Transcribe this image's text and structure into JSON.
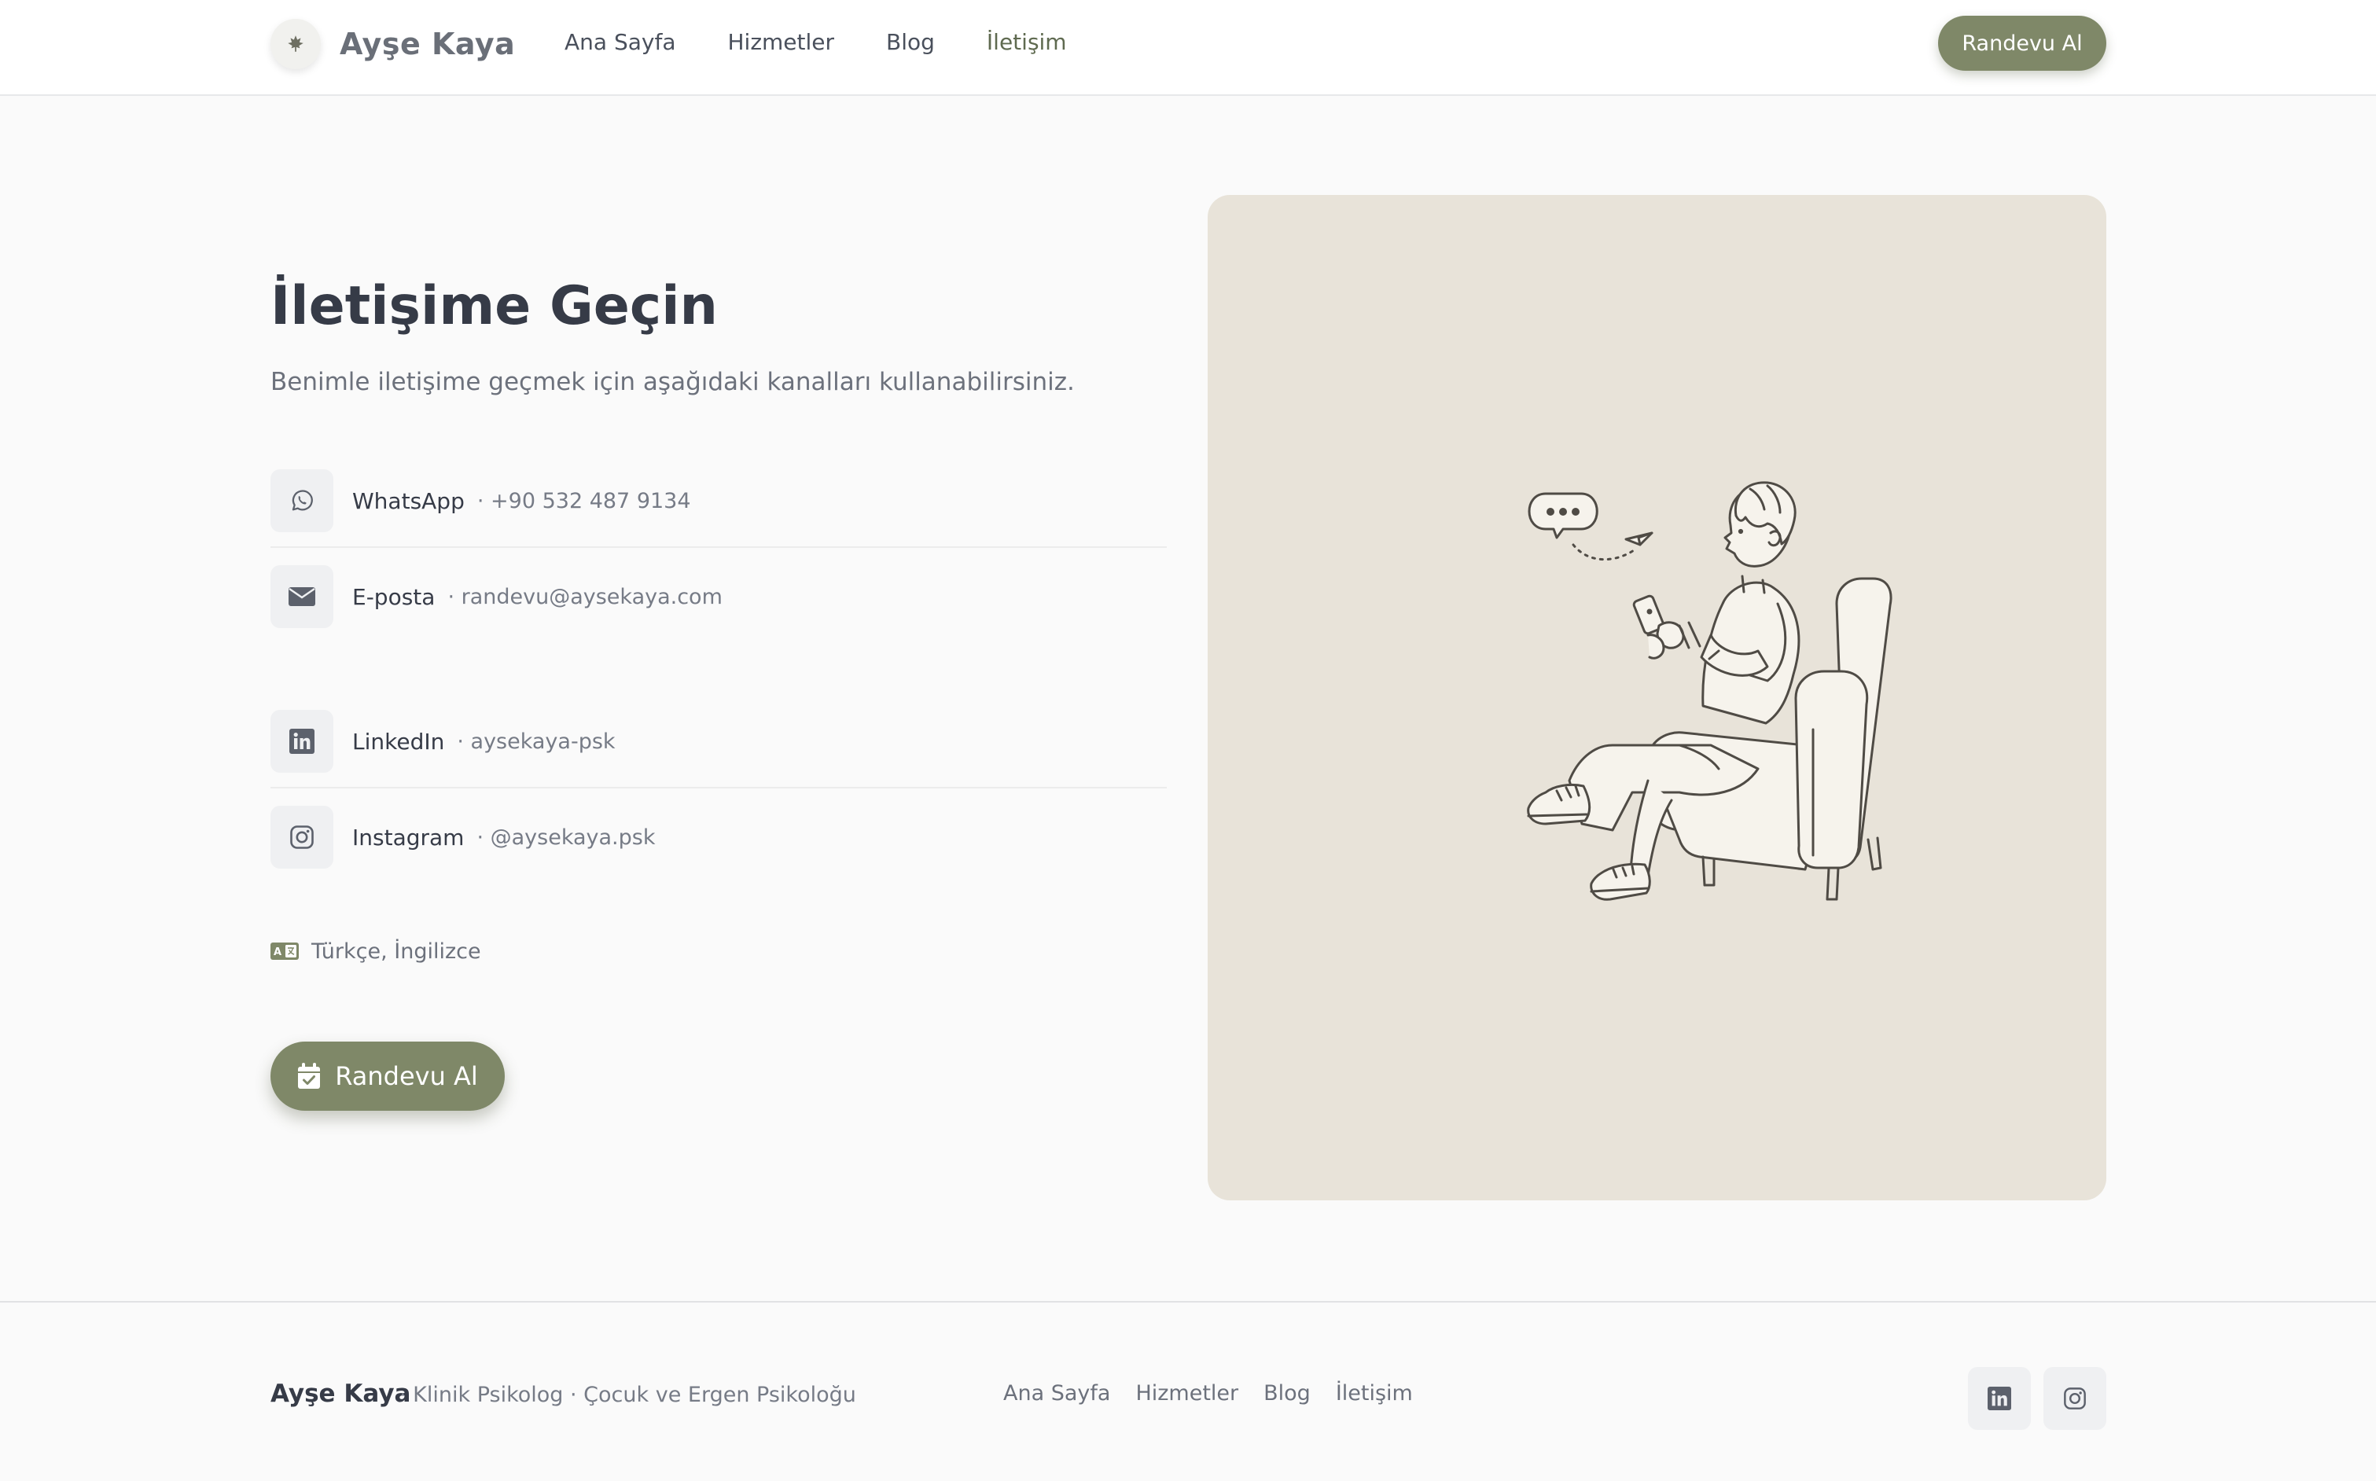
{
  "header": {
    "brand_name": "Ayşe Kaya",
    "brand_icon": "leaf-icon",
    "nav": [
      "Ana Sayfa",
      "Hizmetler",
      "Blog",
      "İletişim"
    ],
    "active_nav": "İletişim",
    "cta_label": "Randevu Al"
  },
  "main": {
    "title": "İletişime Geçin",
    "subtitle": "Benimle iletişime geçmek için aşağıdaki kanalları kullanabilirsiniz.",
    "contacts": [
      {
        "icon": "whatsapp-icon",
        "label": "WhatsApp",
        "value": "· +90 532 487 9134"
      },
      {
        "icon": "email-icon",
        "label": "E-posta",
        "value": "· randevu@aysekaya.com"
      },
      {
        "icon": "linkedin-icon",
        "label": "LinkedIn",
        "value": "· aysekaya-psk"
      },
      {
        "icon": "instagram-icon",
        "label": "Instagram",
        "value": "· @aysekaya.psk"
      }
    ],
    "languages": "Türkçe, İngilizce",
    "languages_icon": "translate-icon",
    "cta_label": "Randevu Al",
    "cta_icon": "calendar-check-icon"
  },
  "illustration": {
    "name": "person-in-armchair-texting-illustration"
  },
  "footer": {
    "brand": "Ayşe Kaya",
    "tagline": "· Klinik Psikolog · Çocuk ve Ergen Psikoloğu",
    "nav": [
      "Ana Sayfa",
      "Hizmetler",
      "Blog",
      "İletişim"
    ],
    "social_icons": [
      "linkedin-icon",
      "instagram-icon"
    ]
  },
  "colors": {
    "accent": "#7f8868",
    "panel": "#e8e3d9",
    "background": "#fafafa",
    "text": "#363b47",
    "muted_text": "#767b86"
  }
}
